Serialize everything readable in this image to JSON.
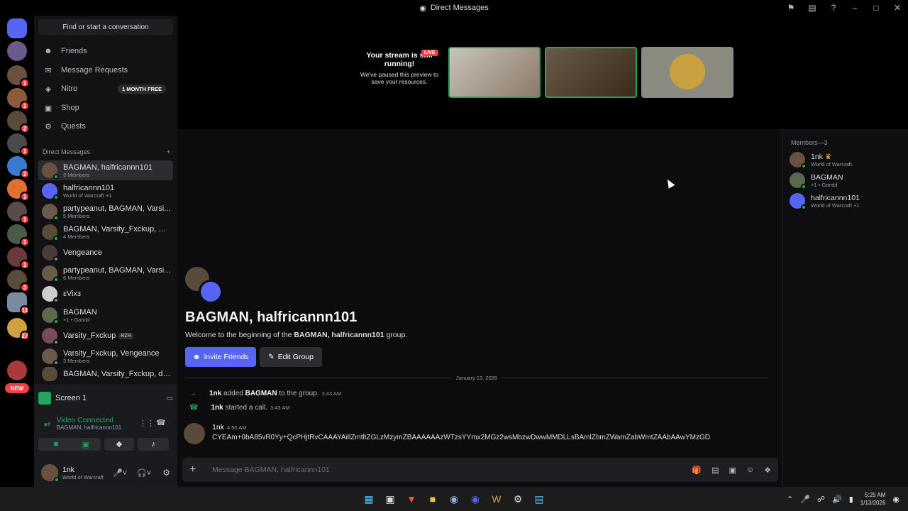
{
  "window": {
    "title": "Direct Messages"
  },
  "sidebar": {
    "search_label": "Find or start a conversation",
    "nav": [
      {
        "label": "Friends",
        "icon": "friends-icon"
      },
      {
        "label": "Message Requests",
        "icon": "mail-icon"
      },
      {
        "label": "Nitro",
        "icon": "nitro-icon",
        "badge": "1 MONTH FREE"
      },
      {
        "label": "Shop",
        "icon": "shop-icon"
      },
      {
        "label": "Quests",
        "icon": "quests-icon"
      }
    ],
    "dm_header": "Direct Messages",
    "dms": [
      {
        "name": "BAGMAN, halfricannn101",
        "sub": "3 Members"
      },
      {
        "name": "halfricannn101",
        "sub": "World of Warcraft +1"
      },
      {
        "name": "partypeanut, BAGMAN, Varsi...",
        "sub": "5 Members"
      },
      {
        "name": "BAGMAN, Varsity_Fxckup, Ve...",
        "sub": "4 Members"
      },
      {
        "name": "Vengeance",
        "sub": ""
      },
      {
        "name": "partypeanut, BAGMAN, Varsi...",
        "sub": "6 Members"
      },
      {
        "name": "εVixз",
        "sub": ""
      },
      {
        "name": "BAGMAN",
        "sub": "+1 • Gambl"
      },
      {
        "name": "Varsity_Fxckup",
        "sub": "",
        "tag": "RZR"
      },
      {
        "name": "Varsity_Fxckup, Vengeance",
        "sub": "3 Members"
      },
      {
        "name": "BAGMAN, Varsity_Fxckup, de...",
        "sub": ""
      }
    ],
    "server_badges": [
      "1",
      "1",
      "2",
      "1",
      "2",
      "1",
      "1",
      "1",
      "1",
      "3",
      "11",
      "27"
    ],
    "new_label": "NEW"
  },
  "voice": {
    "screen_label": "Screen 1",
    "status": "Video Connected",
    "channel": "BAGMAN, halfricannn101"
  },
  "user": {
    "name": "1nk",
    "status": "World of Warcraft"
  },
  "stream": {
    "title": "Your stream is still running!",
    "subtitle": "We've paused this preview to save your resources.",
    "live": "LIVE"
  },
  "channel": {
    "title": "BAGMAN, halfricannn101",
    "welcome_prefix": "Welcome to the beginning of the ",
    "welcome_name": "BAGMAN, halfricannn101",
    "welcome_suffix": " group.",
    "invite_label": "Invite Friends",
    "edit_label": "Edit Group",
    "date": "January 13, 2026"
  },
  "messages": {
    "sys1": {
      "author": "1nk",
      "action": " added ",
      "target": "BAGMAN",
      "rest": " to the group.",
      "time": "3:43 AM"
    },
    "sys2": {
      "author": "1nk",
      "action": " started a call.",
      "time": "3:43 AM"
    },
    "msg1": {
      "author": "1nk",
      "time": "4:50 AM",
      "text": "CYEAm+0bA85vR0Yy+QcPHjtRvCAAAYAillZmtltZGLzMzymZBAAAAAAzWTzsYYmx2MGz2wsMbzwDwwMMDLLsBAmlZbmZWamZabWmtZAAbAAwYMzGD"
    }
  },
  "composer": {
    "placeholder": "Message BAGMAN, halfricannn101"
  },
  "members": {
    "header": "Members—3",
    "list": [
      {
        "name": "1nk",
        "sub": "World of Warcraft",
        "crown": true
      },
      {
        "name": "BAGMAN",
        "sub": "+1 • Gambl"
      },
      {
        "name": "halfricannn101",
        "sub": "World of Warcraft +1"
      }
    ]
  },
  "taskbar": {
    "time": "5:25 AM",
    "date": "1/13/2026"
  }
}
